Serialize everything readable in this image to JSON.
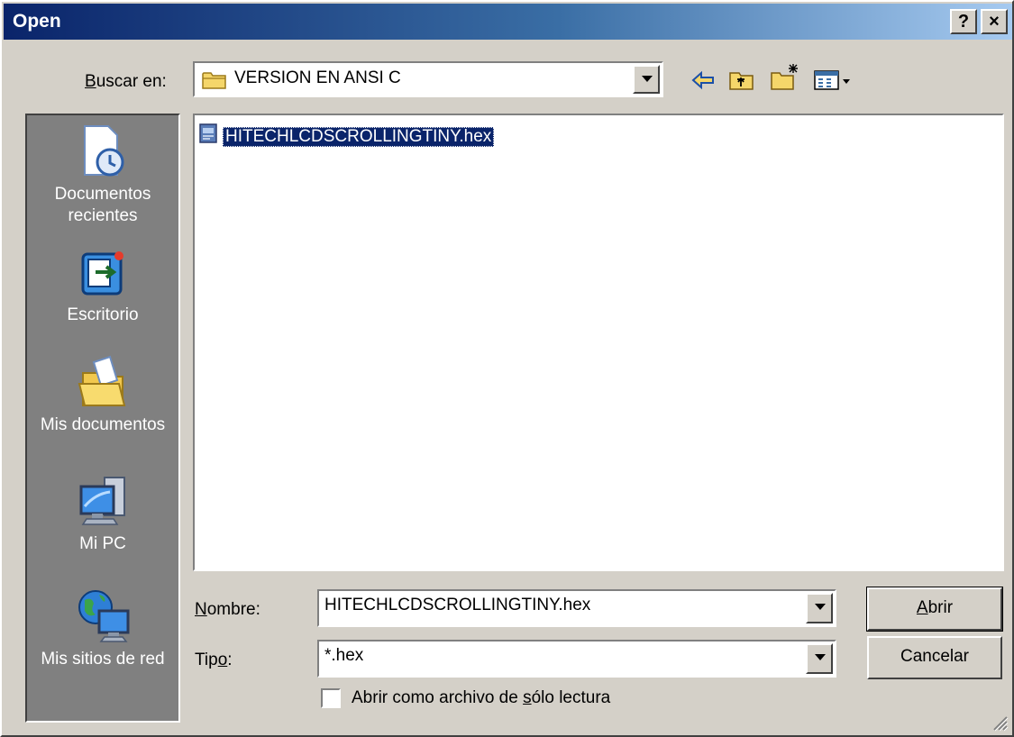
{
  "window": {
    "title": "Open",
    "help_label": "?",
    "close_label": "×"
  },
  "lookin": {
    "label": "Buscar en:",
    "value": "VERSION EN ANSI C"
  },
  "places": [
    {
      "label_line1": "Documentos",
      "label_line2": "recientes",
      "icon": "recent-documents-icon"
    },
    {
      "label_line1": "Escritorio",
      "label_line2": "",
      "icon": "desktop-icon"
    },
    {
      "label_line1": "Mis documentos",
      "label_line2": "",
      "icon": "my-documents-icon"
    },
    {
      "label_line1": "Mi PC",
      "label_line2": "",
      "icon": "my-computer-icon"
    },
    {
      "label_line1": "Mis sitios de red",
      "label_line2": "",
      "icon": "network-places-icon"
    }
  ],
  "files": [
    {
      "name": "HITECHLCDSCROLLINGTINY.hex",
      "selected": true
    }
  ],
  "filename": {
    "label": "Nombre:",
    "value": "HITECHLCDSCROLLINGTINY.hex"
  },
  "filetype": {
    "label": "Tipo:",
    "value": "*.hex"
  },
  "readonly": {
    "label": "Abrir como archivo de sólo lectura",
    "checked": false
  },
  "buttons": {
    "open": "Abrir",
    "cancel": "Cancelar"
  },
  "colors": {
    "title_gradient_start": "#0a246a",
    "title_gradient_end": "#a6caf0",
    "face": "#d4d0c8",
    "selection": "#0a246a"
  }
}
